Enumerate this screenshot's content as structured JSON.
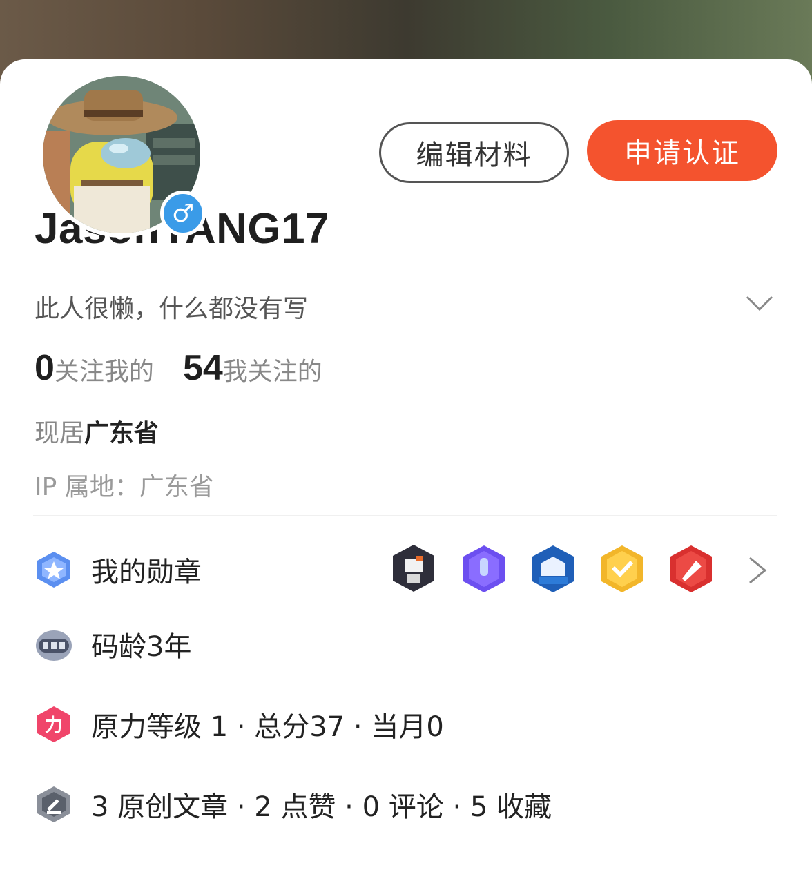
{
  "profile": {
    "username": "JasonYANG17",
    "bio": "此人很懒，什么都没有写",
    "gender_icon": "male-icon"
  },
  "actions": {
    "edit_label": "编辑材料",
    "certify_label": "申请认证"
  },
  "stats": {
    "followers_count": "0",
    "followers_label": "关注我的",
    "following_count": "54",
    "following_label": "我关注的"
  },
  "location": {
    "residence_label": "现居",
    "residence_value": "广东省",
    "ip_text": "IP 属地：广东省"
  },
  "rows": {
    "medals_label": "我的勋章",
    "code_age": "码龄3年",
    "power_level": "原力等级 1 · 总分37 · 当月0",
    "activity": "3 原创文章 · 2 点赞 · 0 评论 · 5 收藏"
  },
  "colors": {
    "accent": "#f4532e",
    "gender_badge": "#3a9be8"
  }
}
